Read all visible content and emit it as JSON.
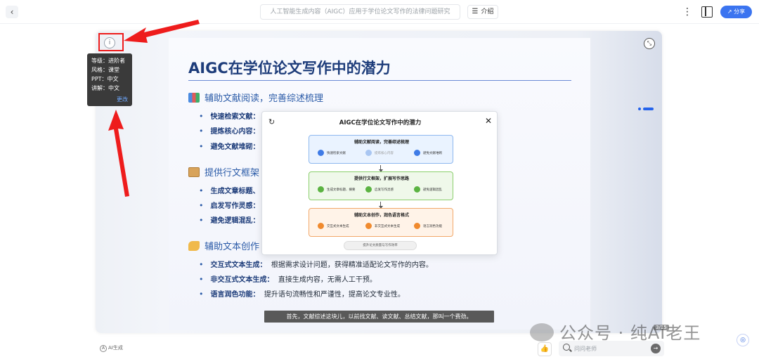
{
  "topbar": {
    "back_icon": "chevron-left-icon",
    "doc_title": "人工智能生成内容（AIGC）应用于学位论文写作的法律问题研究",
    "intro_label": "介绍",
    "more_icon": "more-vertical-icon",
    "layout_icon": "sidebar-layout-icon",
    "share_label": "分享"
  },
  "info_tooltip": {
    "lines": [
      "等级：进阶者",
      "风格：课堂",
      "PPT：中文",
      "讲解：中文"
    ],
    "change_label": "更改"
  },
  "slide": {
    "title": "AIGC在学位论文写作中的潜力",
    "sections": [
      {
        "heading": "辅助文献阅读，完善综述梳理",
        "icon": "books-icon",
        "bullets": [
          {
            "label": "快速检索文献："
          },
          {
            "label": "提炼核心内容："
          },
          {
            "label": "避免文献堆砌："
          }
        ]
      },
      {
        "heading": "提供行文框架",
        "icon": "clipboard-icon",
        "bullets": [
          {
            "label": "生成文章标题、"
          },
          {
            "label": "启发写作灵感："
          },
          {
            "label": "避免逻辑混乱："
          }
        ]
      },
      {
        "heading": "辅助文本创作",
        "icon": "writing-hand-icon",
        "bullets": [
          {
            "label": "交互式文本生成：",
            "text": "根据需求设计问题，获得精准适配论文写作的内容。"
          },
          {
            "label": "非交互式文本生成：",
            "text": "直接生成内容，无需人工干预。"
          },
          {
            "label": "语言润色功能：",
            "text": "提升语句流畅性和严谨性，提高论文专业性。"
          }
        ]
      }
    ],
    "subtitle": "首先，文献综述这块儿，以前找文献、读文献、总结文献，那叫一个费劲。"
  },
  "modal": {
    "title": "AIGC在学位论文写作中的潜力",
    "boxes": [
      {
        "title": "辅助文献阅读，完善综述梳理",
        "items": [
          "快速检索文献",
          "提炼核心内容",
          "避免文献堆砌"
        ]
      },
      {
        "title": "提供行文框架，扩展写作思路",
        "items": [
          "生成文章标题、摘要",
          "启发写作灵感",
          "避免逻辑混乱"
        ]
      },
      {
        "title": "辅助文本创作，润色语言格式",
        "items": [
          "交互式文本生成",
          "非交互式文本生成",
          "语言润色功能"
        ]
      }
    ],
    "footer": "提升论文质量与写作效率"
  },
  "colors": {
    "accent": "#3b74f0",
    "title": "#1d3c7a",
    "section": "#2b5ba8",
    "annotation_red": "#ee1c1c"
  },
  "page_indicator": "3/15",
  "watermark": "公众号 · 纯AI老王",
  "ai_mark": "AI生成",
  "ask": {
    "placeholder": "问问老师"
  }
}
